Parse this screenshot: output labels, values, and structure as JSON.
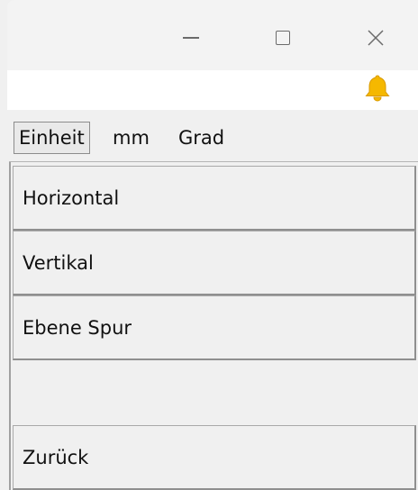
{
  "window": {
    "controls": {
      "minimize": "minimize-icon",
      "maximize": "maximize-icon",
      "close": "close-icon"
    }
  },
  "notification": {
    "icon": "bell-icon",
    "icon_color": "#F5B800"
  },
  "units": {
    "button_label": "Einheit",
    "length_unit": "mm",
    "angle_unit": "Grad"
  },
  "menu": {
    "items": [
      {
        "label": "Horizontal"
      },
      {
        "label": "Vertikal"
      },
      {
        "label": "Ebene Spur"
      },
      {
        "label": "Zurück"
      }
    ]
  }
}
